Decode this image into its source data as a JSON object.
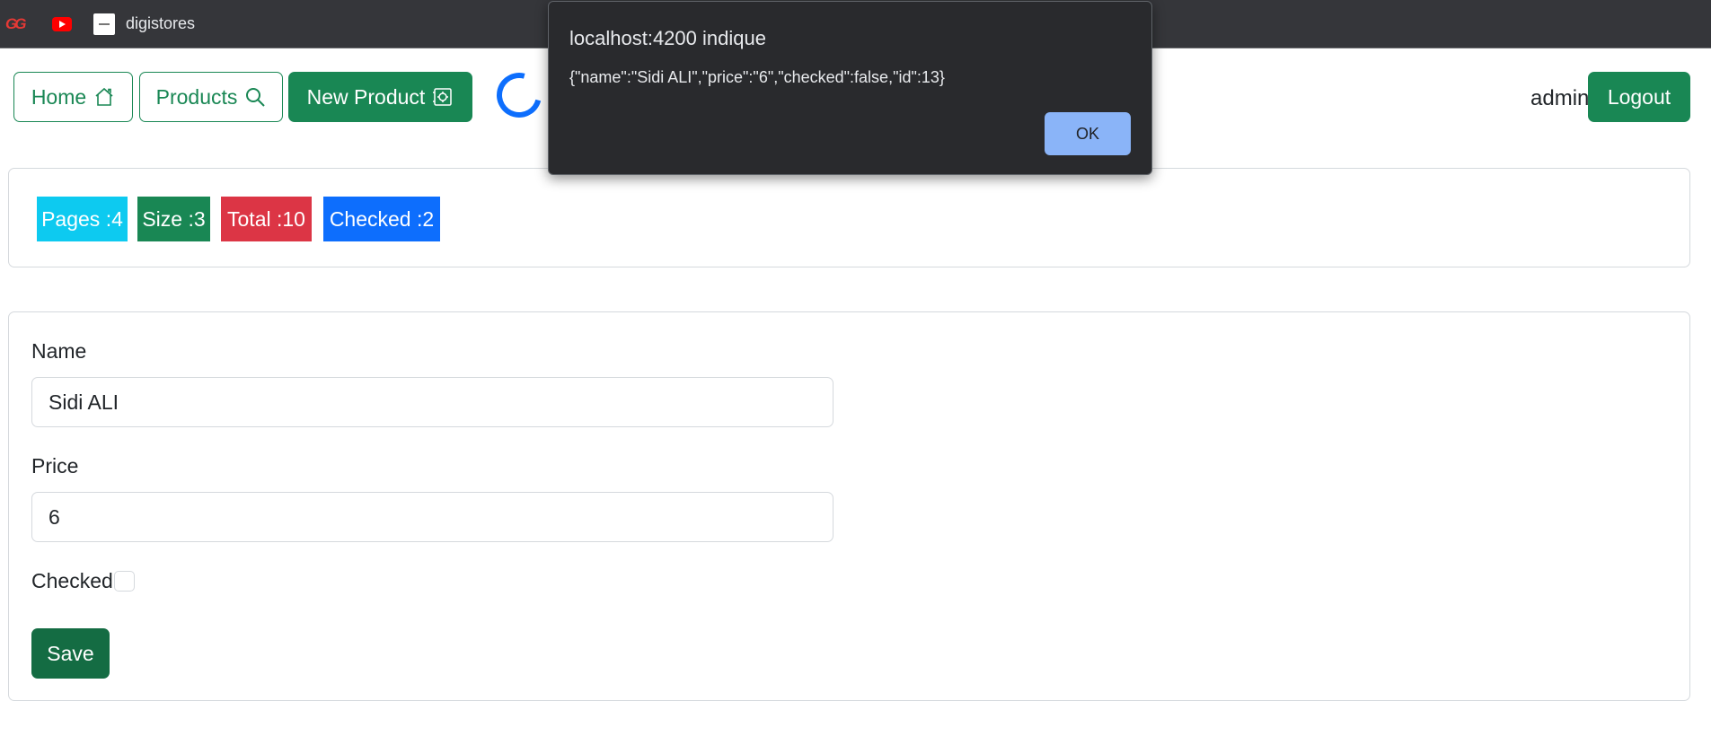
{
  "bookmarks": {
    "items": [
      {
        "icon": "gg-logo-icon"
      },
      {
        "icon": "youtube-icon"
      },
      {
        "icon": "digistores-icon",
        "label": "digistores"
      }
    ]
  },
  "navbar": {
    "home_label": "Home",
    "products_label": "Products",
    "new_product_label": "New Product",
    "username": "admin",
    "logout_label": "Logout"
  },
  "stats": {
    "pages": "Pages :4",
    "size": "Size :3",
    "total": "Total :10",
    "checked": "Checked :2",
    "colors": {
      "pages": "#0dcaf0",
      "size": "#198754",
      "total": "#dc3545",
      "checked": "#0d6efd"
    }
  },
  "form": {
    "name_label": "Name",
    "name_value": "Sidi ALI",
    "price_label": "Price",
    "price_value": "6",
    "checked_label": "Checked",
    "checked_value": false,
    "save_label": "Save"
  },
  "alert": {
    "title": "localhost:4200 indique",
    "message": "{\"name\":\"Sidi ALI\",\"price\":\"6\",\"checked\":false,\"id\":13}",
    "ok_label": "OK"
  },
  "colors": {
    "primary_green": "#198754",
    "dark_green": "#146c43",
    "spinner_blue": "#0d6efd",
    "dialog_bg": "#292a2d",
    "dialog_ok": "#8ab4f8"
  }
}
